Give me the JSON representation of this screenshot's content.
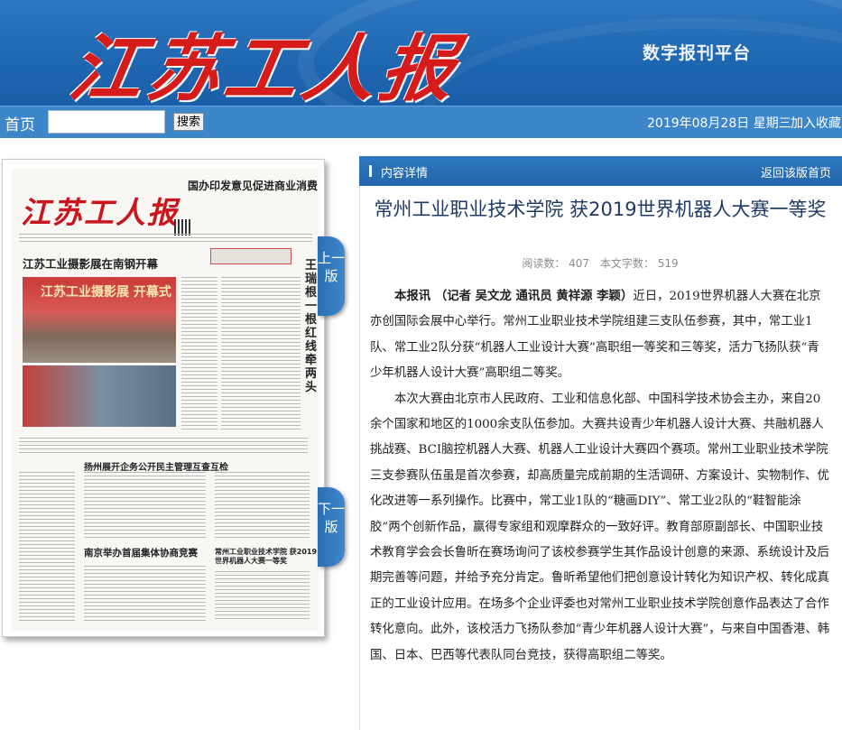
{
  "header": {
    "logo_text": "江苏工人报",
    "platform_label": "数字报刊平台"
  },
  "nav": {
    "home": "首页",
    "search_button": "搜索",
    "search_value": "",
    "date": "2019年08月28日 星期三",
    "favorite": "加入收藏"
  },
  "page_tabs": {
    "prev": "上一版",
    "next": "下一版"
  },
  "newspaper": {
    "masthead": "江苏工人报",
    "headlines": [
      "国办印发意见促进商业消费",
      "江苏工业摄影展在南钢开幕",
      "扬州展开企务公开民主管理互查互检",
      "南京举办首届集体协商竞赛",
      "常州工业职业技术学院 获2019世界机器人大赛一等奖"
    ],
    "vertical_title": "王瑞根：一根红线牵两头",
    "photo_caption": "江苏工业摄影展 开幕式"
  },
  "panel": {
    "section_label": "内容详情",
    "back_link": "返回该版首页"
  },
  "article": {
    "title": "常州工业职业技术学院 获2019世界机器人大赛一等奖",
    "reads": "阅读数：  407",
    "word_count": "本文字数：  519",
    "lead": "本报讯 （记者 吴文龙  通讯员 黄祥源  李颖）",
    "p1_rest": "近日，2019世界机器人大赛在北京亦创国际会展中心举行。常州工业职业技术学院组建三支队伍参赛，其中，常工业1队、常工业2队分获“机器人工业设计大赛”高职组一等奖和三等奖，活力飞扬队获“青少年机器人设计大赛”高职组二等奖。",
    "p2": "本次大赛由北京市人民政府、工业和信息化部、中国科学技术协会主办，来自20余个国家和地区的1000余支队伍参加。大赛共设青少年机器人设计大赛、共融机器人挑战赛、BCI脑控机器人大赛、机器人工业设计大赛四个赛项。常州工业职业技术学院三支参赛队伍虽是首次参赛，却高质量完成前期的生活调研、方案设计、实物制作、优化改进等一系列操作。比赛中，常工业1队的“糖画DIY”、常工业2队的“鞋智能涂胶”两个创新作品，赢得专家组和观摩群众的一致好评。教育部原副部长、中国职业技术教育学会会长鲁昕在赛场询问了该校参赛学生其作品设计创意的来源、系统设计及后期完善等问题，并给予充分肯定。鲁昕希望他们把创意设计转化为知识产权、转化成真正的工业设计应用。在场多个企业评委也对常州工业职业技术学院创意作品表达了合作转化意向。此外，该校活力飞扬队参加“青少年机器人设计大赛”，与来自中国香港、韩国、日本、巴西等代表队同台竞技，获得高职组二等奖。"
  }
}
